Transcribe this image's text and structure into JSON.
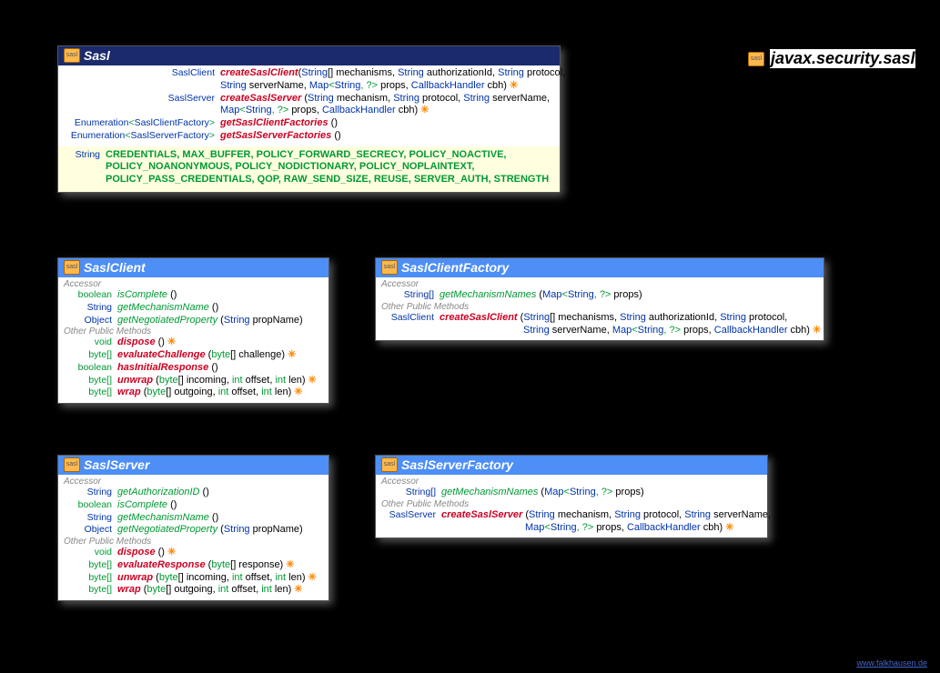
{
  "package": {
    "name": "javax.security.sasl"
  },
  "sasl": {
    "title": "Sasl",
    "m1": {
      "ret": "SaslClient",
      "name": "createSaslClient",
      "sig1a": "(",
      "p1t": "String",
      "p1s": "[] mechanisms, ",
      "p2t": "String",
      "p2s": " authorizationId, ",
      "p3t": "String",
      "p3s": " protocol,",
      "cont_prefix": "",
      "p4t": "String",
      "p4s": " serverName, ",
      "p5t": "Map",
      "p5g": "<",
      "p5ga": "String",
      "p5gs": ", ?> ",
      "p5s": "props, ",
      "p6t": "CallbackHandler",
      "p6s": " cbh)",
      "throws": " ✳"
    },
    "m2": {
      "ret": "SaslServer",
      "name": "createSaslServer",
      "p1t": "String",
      "p1s": " mechanism, ",
      "p2t": "String",
      "p2s": " protocol, ",
      "p3t": "String",
      "p3s": " serverName,",
      "p4t": "Map",
      "p4g": "<",
      "p4ga": "String",
      "p4gs": ", ?> ",
      "p4s": "props, ",
      "p5t": "CallbackHandler",
      "p5s": " cbh)",
      "throws": " ✳"
    },
    "m3": {
      "retA": "Enumeration",
      "retG": "<",
      "retB": "SaslClientFactory",
      "retC": ">",
      "name": "getSaslClientFactories",
      "sig": " ()"
    },
    "m4": {
      "retA": "Enumeration",
      "retG": "<",
      "retB": "SaslServerFactory",
      "retC": ">",
      "name": "getSaslServerFactories",
      "sig": " ()"
    },
    "constRet": "String",
    "constants1": "CREDENTIALS, MAX_BUFFER, POLICY_FORWARD_SECRECY, POLICY_NOACTIVE,",
    "constants2": "POLICY_NOANONYMOUS, POLICY_NODICTIONARY, POLICY_NOPLAINTEXT,",
    "constants3": "POLICY_PASS_CREDENTIALS, QOP, RAW_SEND_SIZE, REUSE, SERVER_AUTH, STRENGTH"
  },
  "saslClient": {
    "title": "SaslClient",
    "secAccessor": "Accessor",
    "secOther": "Other Public Methods",
    "a1": {
      "ret": "boolean",
      "name": "isComplete",
      "sig": " ()"
    },
    "a2": {
      "ret": "String",
      "name": "getMechanismName",
      "sig": " ()"
    },
    "a3": {
      "ret": "Object",
      "name": "getNegotiatedProperty",
      "pfx": " (",
      "p1t": "String",
      "p1s": " propName)"
    },
    "o1": {
      "ret": "void",
      "name": "dispose",
      "sig": " ()",
      "throws": " ✳"
    },
    "o2": {
      "ret": "byte[]",
      "name": "evaluateChallenge",
      "pfx": " (",
      "p1t": "byte",
      "p1s": "[] challenge)",
      "throws": " ✳"
    },
    "o3": {
      "ret": "boolean",
      "name": "hasInitialResponse",
      "sig": " ()"
    },
    "o4": {
      "ret": "byte[]",
      "name": "unwrap",
      "pfx": " (",
      "p1t": "byte",
      "p1s": "[] incoming, ",
      "p2t": "int",
      "p2s": " offset, ",
      "p3t": "int",
      "p3s": " len)",
      "throws": " ✳"
    },
    "o5": {
      "ret": "byte[]",
      "name": "wrap",
      "pfx": " (",
      "p1t": "byte",
      "p1s": "[] outgoing, ",
      "p2t": "int",
      "p2s": " offset, ",
      "p3t": "int",
      "p3s": " len)",
      "throws": " ✳"
    }
  },
  "saslClientFactory": {
    "title": "SaslClientFactory",
    "secAccessor": "Accessor",
    "secOther": "Other Public Methods",
    "a1": {
      "ret": "String[]",
      "name": "getMechanismNames",
      "pfx": " (",
      "p1t": "Map",
      "p1g": "<",
      "p1ga": "String",
      "p1gs": ", ?> ",
      "p1s": "props)"
    },
    "o1": {
      "ret": "SaslClient",
      "name": "createSaslClient",
      "p1t": "String",
      "p1s": "[] mechanisms, ",
      "p2t": "String",
      "p2s": " authorizationId, ",
      "p3t": "String",
      "p3s": " protocol,",
      "p4t": "String",
      "p4s": " serverName, ",
      "p5t": "Map",
      "p5g": "<",
      "p5ga": "String",
      "p5gs": ", ?> ",
      "p5s": "props, ",
      "p6t": "CallbackHandler",
      "p6s": " cbh)",
      "throws": " ✳"
    }
  },
  "saslServer": {
    "title": "SaslServer",
    "secAccessor": "Accessor",
    "secOther": "Other Public Methods",
    "a1": {
      "ret": "String",
      "name": "getAuthorizationID",
      "sig": " ()"
    },
    "a2": {
      "ret": "boolean",
      "name": "isComplete",
      "sig": " ()"
    },
    "a3": {
      "ret": "String",
      "name": "getMechanismName",
      "sig": " ()"
    },
    "a4": {
      "ret": "Object",
      "name": "getNegotiatedProperty",
      "pfx": " (",
      "p1t": "String",
      "p1s": " propName)"
    },
    "o1": {
      "ret": "void",
      "name": "dispose",
      "sig": " ()",
      "throws": " ✳"
    },
    "o2": {
      "ret": "byte[]",
      "name": "evaluateResponse",
      "pfx": " (",
      "p1t": "byte",
      "p1s": "[] response)",
      "throws": " ✳"
    },
    "o3": {
      "ret": "byte[]",
      "name": "unwrap",
      "pfx": " (",
      "p1t": "byte",
      "p1s": "[] incoming, ",
      "p2t": "int",
      "p2s": " offset, ",
      "p3t": "int",
      "p3s": " len)",
      "throws": " ✳"
    },
    "o4": {
      "ret": "byte[]",
      "name": "wrap",
      "pfx": " (",
      "p1t": "byte",
      "p1s": "[] outgoing, ",
      "p2t": "int",
      "p2s": " offset, ",
      "p3t": "int",
      "p3s": " len)",
      "throws": " ✳"
    }
  },
  "saslServerFactory": {
    "title": "SaslServerFactory",
    "secAccessor": "Accessor",
    "secOther": "Other Public Methods",
    "a1": {
      "ret": "String[]",
      "name": "getMechanismNames",
      "pfx": " (",
      "p1t": "Map",
      "p1g": "<",
      "p1ga": "String",
      "p1gs": ", ?> ",
      "p1s": "props)"
    },
    "o1": {
      "ret": "SaslServer",
      "name": "createSaslServer",
      "p1t": "String",
      "p1s": " mechanism, ",
      "p2t": "String",
      "p2s": " protocol, ",
      "p3t": "String",
      "p3s": " serverName,",
      "p4t": "Map",
      "p4g": "<",
      "p4ga": "String",
      "p4gs": ", ?> ",
      "p4s": "props, ",
      "p5t": "CallbackHandler",
      "p5s": " cbh)",
      "throws": " ✳"
    }
  },
  "footer": "www.falkhausen.de"
}
